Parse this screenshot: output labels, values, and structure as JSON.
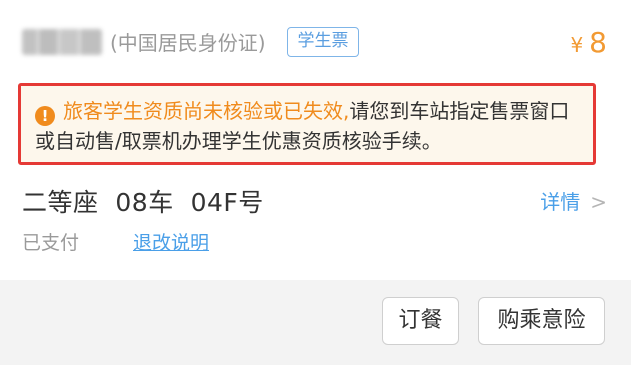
{
  "ticket": {
    "id_type": "(中国居民身份证)",
    "badge": "学生票",
    "currency": "¥",
    "price": "8",
    "alert_highlight": "旅客学生资质尚未核验或已失效,",
    "alert_rest": "请您到车站指定售票窗口或自动售/取票机办理学生优惠资质核验手续。",
    "seat": "二等座  08车  04F号",
    "detail_link": "详情",
    "status": "已支付",
    "refund_link": "退改说明"
  },
  "actions": {
    "meal": "订餐",
    "insurance": "购乘意险"
  },
  "colors": {
    "accent": "#f29a33",
    "link": "#4a9fe8",
    "alert_border": "#e53935"
  },
  "icons": {
    "warning": "warning-icon",
    "chevron": "chevron-right-icon"
  }
}
